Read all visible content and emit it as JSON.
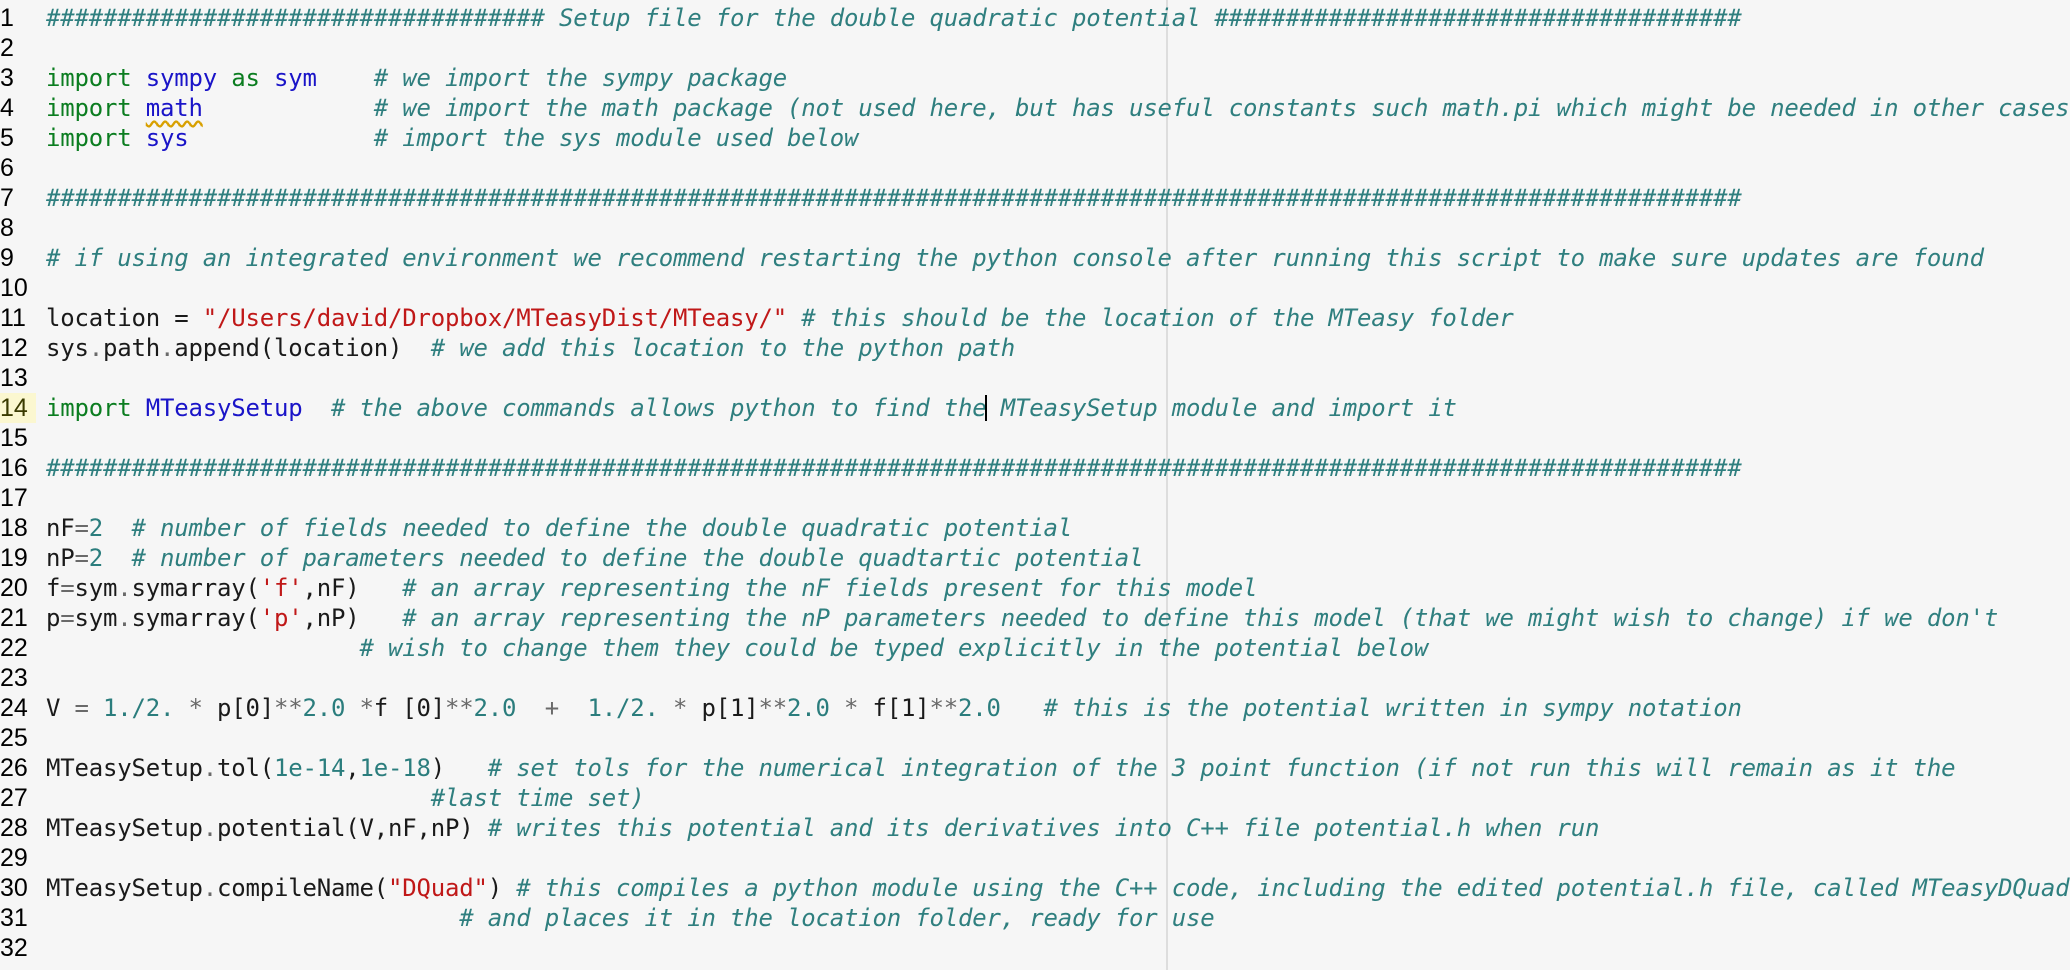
{
  "editor": {
    "current_line": 14,
    "lines": [
      {
        "n": "1",
        "segments": [
          {
            "t": "################################### Setup file for the double quadratic potential #####################################",
            "c": "c"
          }
        ]
      },
      {
        "n": "2",
        "segments": []
      },
      {
        "n": "3",
        "segments": [
          {
            "t": "import",
            "c": "k"
          },
          {
            "t": " "
          },
          {
            "t": "sympy",
            "c": "m"
          },
          {
            "t": " "
          },
          {
            "t": "as",
            "c": "k"
          },
          {
            "t": " "
          },
          {
            "t": "sym",
            "c": "m"
          },
          {
            "t": "    "
          },
          {
            "t": "# we import the sympy package",
            "c": "c"
          }
        ]
      },
      {
        "n": "4",
        "segments": [
          {
            "t": "import",
            "c": "k"
          },
          {
            "t": " "
          },
          {
            "t": "math",
            "c": "m spell"
          },
          {
            "t": "            "
          },
          {
            "t": "# we import the math package (not used here, but has useful constants such math.pi which might be needed in other cases)",
            "c": "c"
          }
        ]
      },
      {
        "n": "5",
        "segments": [
          {
            "t": "import",
            "c": "k"
          },
          {
            "t": " "
          },
          {
            "t": "sys",
            "c": "m"
          },
          {
            "t": "             "
          },
          {
            "t": "# import the sys module used below",
            "c": "c"
          }
        ]
      },
      {
        "n": "6",
        "segments": []
      },
      {
        "n": "7",
        "segments": [
          {
            "t": "#######################################################################################################################",
            "c": "c"
          }
        ]
      },
      {
        "n": "8",
        "segments": []
      },
      {
        "n": "9",
        "segments": [
          {
            "t": "# if using an integrated environment we recommend restarting the python console after running this script to make sure updates are found",
            "c": "c"
          }
        ]
      },
      {
        "n": "10",
        "segments": []
      },
      {
        "n": "11",
        "segments": [
          {
            "t": "location = "
          },
          {
            "t": "\"/Users/david/Dropbox/MTeasyDist/MTeasy/\"",
            "c": "s"
          },
          {
            "t": " "
          },
          {
            "t": "# this should be the location of the MTeasy folder",
            "c": "c"
          }
        ]
      },
      {
        "n": "12",
        "segments": [
          {
            "t": "sys"
          },
          {
            "t": ".",
            "c": "o"
          },
          {
            "t": "path"
          },
          {
            "t": ".",
            "c": "o"
          },
          {
            "t": "append(location)  "
          },
          {
            "t": "# we add this location to the python path",
            "c": "c"
          }
        ]
      },
      {
        "n": "13",
        "segments": []
      },
      {
        "n": "14",
        "segments": [
          {
            "t": "import",
            "c": "k"
          },
          {
            "t": " "
          },
          {
            "t": "MTeasySetup",
            "c": "m"
          },
          {
            "t": "  "
          },
          {
            "t": "# the above commands allows python to find the MTeasySetup module and import it",
            "c": "c"
          }
        ]
      },
      {
        "n": "15",
        "segments": []
      },
      {
        "n": "16",
        "segments": [
          {
            "t": "#######################################################################################################################",
            "c": "c"
          }
        ]
      },
      {
        "n": "17",
        "segments": []
      },
      {
        "n": "18",
        "segments": [
          {
            "t": "nF"
          },
          {
            "t": "=",
            "c": "o"
          },
          {
            "t": "2",
            "c": "n"
          },
          {
            "t": "  "
          },
          {
            "t": "# number of fields needed to define the double quadratic potential",
            "c": "c"
          }
        ]
      },
      {
        "n": "19",
        "segments": [
          {
            "t": "nP"
          },
          {
            "t": "=",
            "c": "o"
          },
          {
            "t": "2",
            "c": "n"
          },
          {
            "t": "  "
          },
          {
            "t": "# number of parameters needed to define the double quadtartic potential",
            "c": "c"
          }
        ]
      },
      {
        "n": "20",
        "segments": [
          {
            "t": "f"
          },
          {
            "t": "=",
            "c": "o"
          },
          {
            "t": "sym"
          },
          {
            "t": ".",
            "c": "o"
          },
          {
            "t": "symarray("
          },
          {
            "t": "'f'",
            "c": "s"
          },
          {
            "t": ",nF)   "
          },
          {
            "t": "# an array representing the nF fields present for this model",
            "c": "c"
          }
        ]
      },
      {
        "n": "21",
        "segments": [
          {
            "t": "p"
          },
          {
            "t": "=",
            "c": "o"
          },
          {
            "t": "sym"
          },
          {
            "t": ".",
            "c": "o"
          },
          {
            "t": "symarray("
          },
          {
            "t": "'p'",
            "c": "s"
          },
          {
            "t": ",nP)   "
          },
          {
            "t": "# an array representing the nP parameters needed to define this model (that we might wish to change) if we don't",
            "c": "c"
          }
        ]
      },
      {
        "n": "22",
        "segments": [
          {
            "t": "                      "
          },
          {
            "t": "# wish to change them they could be typed explicitly in the potential below",
            "c": "c"
          }
        ]
      },
      {
        "n": "23",
        "segments": []
      },
      {
        "n": "24",
        "segments": [
          {
            "t": "V "
          },
          {
            "t": "=",
            "c": "o"
          },
          {
            "t": " "
          },
          {
            "t": "1./2.",
            "c": "n"
          },
          {
            "t": " "
          },
          {
            "t": "*",
            "c": "o"
          },
          {
            "t": " p[0]"
          },
          {
            "t": "**",
            "c": "o"
          },
          {
            "t": "2.0",
            "c": "n"
          },
          {
            "t": " "
          },
          {
            "t": "*",
            "c": "o"
          },
          {
            "t": "f [0]"
          },
          {
            "t": "**",
            "c": "o"
          },
          {
            "t": "2.0",
            "c": "n"
          },
          {
            "t": "  "
          },
          {
            "t": "+",
            "c": "o"
          },
          {
            "t": "  "
          },
          {
            "t": "1./2.",
            "c": "n"
          },
          {
            "t": " "
          },
          {
            "t": "*",
            "c": "o"
          },
          {
            "t": " p[1]"
          },
          {
            "t": "**",
            "c": "o"
          },
          {
            "t": "2.0",
            "c": "n"
          },
          {
            "t": " "
          },
          {
            "t": "*",
            "c": "o"
          },
          {
            "t": " f[1]"
          },
          {
            "t": "**",
            "c": "o"
          },
          {
            "t": "2.0",
            "c": "n"
          },
          {
            "t": "   "
          },
          {
            "t": "# this is the potential written in sympy notation",
            "c": "c"
          }
        ]
      },
      {
        "n": "25",
        "segments": []
      },
      {
        "n": "26",
        "segments": [
          {
            "t": "MTeasySetup"
          },
          {
            "t": ".",
            "c": "o"
          },
          {
            "t": "tol("
          },
          {
            "t": "1e-14",
            "c": "n"
          },
          {
            "t": ","
          },
          {
            "t": "1e-18",
            "c": "n"
          },
          {
            "t": ")   "
          },
          {
            "t": "# set tols for the numerical integration of the 3 point function (if not run this will remain as it the",
            "c": "c"
          }
        ]
      },
      {
        "n": "27",
        "segments": [
          {
            "t": "                           "
          },
          {
            "t": "#last time set)",
            "c": "c"
          }
        ]
      },
      {
        "n": "28",
        "segments": [
          {
            "t": "MTeasySetup"
          },
          {
            "t": ".",
            "c": "o"
          },
          {
            "t": "potential(V,nF,nP) "
          },
          {
            "t": "# writes this potential and its derivatives into C++ file potential.h when run",
            "c": "c"
          }
        ]
      },
      {
        "n": "29",
        "segments": []
      },
      {
        "n": "30",
        "segments": [
          {
            "t": "MTeasySetup"
          },
          {
            "t": ".",
            "c": "o"
          },
          {
            "t": "compileName("
          },
          {
            "t": "\"DQuad\"",
            "c": "s"
          },
          {
            "t": ") "
          },
          {
            "t": "# this compiles a python module using the C++ code, including the edited potential.h file, called MTeasyDQuad",
            "c": "c"
          }
        ]
      },
      {
        "n": "31",
        "segments": [
          {
            "t": "                             "
          },
          {
            "t": "# and places it in the location folder, ready for use",
            "c": "c"
          }
        ]
      },
      {
        "n": "32",
        "segments": []
      }
    ]
  }
}
